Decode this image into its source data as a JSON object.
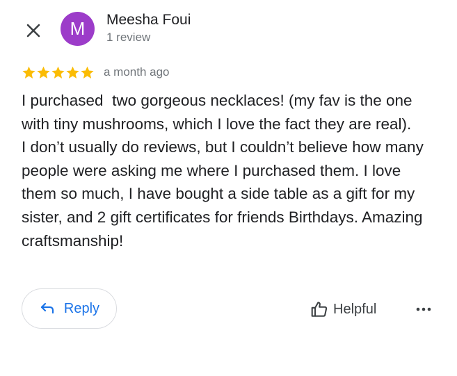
{
  "header": {
    "close_icon": "close-icon",
    "avatar": {
      "initial": "M",
      "color": "#9c3cc9"
    },
    "reviewer_name": "Meesha Foui",
    "reviewer_meta": "1 review"
  },
  "review": {
    "rating": 5,
    "rating_max": 5,
    "star_color": "#fbbc04",
    "time": "a month ago",
    "paragraphs": [
      "I purchased  two gorgeous necklaces! (my fav is the one with tiny mushrooms, which I love the fact they are real).",
      "I don’t usually do reviews, but I couldn’t believe how many people were asking me where I purchased them. I love them so much, I have bought a side table as a gift for my sister, and 2 gift certificates for friends Birthdays. Amazing craftsmanship!"
    ]
  },
  "actions": {
    "reply_label": "Reply",
    "reply_icon": "reply-arrow-icon",
    "helpful_label": "Helpful",
    "helpful_icon": "thumbs-up-icon",
    "more_icon": "more-horizontal-icon",
    "accent_color": "#1a73e8"
  }
}
